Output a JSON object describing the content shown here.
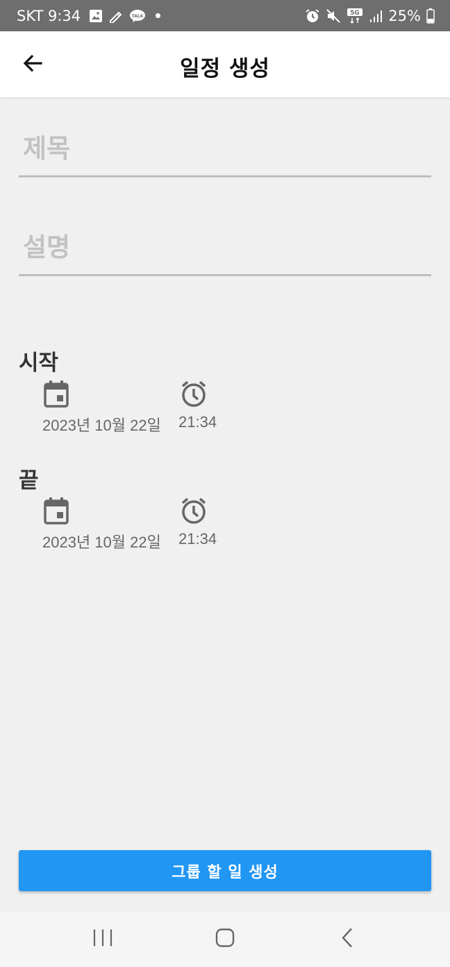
{
  "status_bar": {
    "carrier_time": "SKT 9:34",
    "battery": "25%",
    "network": "5G"
  },
  "app_bar": {
    "title": "일정 생성"
  },
  "form": {
    "title_placeholder": "제목",
    "title_value": "",
    "description_placeholder": "설명",
    "description_value": ""
  },
  "start": {
    "label": "시작",
    "date": "2023년 10월 22일",
    "time": "21:34"
  },
  "end": {
    "label": "끝",
    "date": "2023년 10월 22일",
    "time": "21:34"
  },
  "actions": {
    "create_label": "그룹 할 일 생성"
  },
  "colors": {
    "accent": "#2196f3",
    "background": "#f0f0f0",
    "status_bar": "#6e6e6e"
  }
}
